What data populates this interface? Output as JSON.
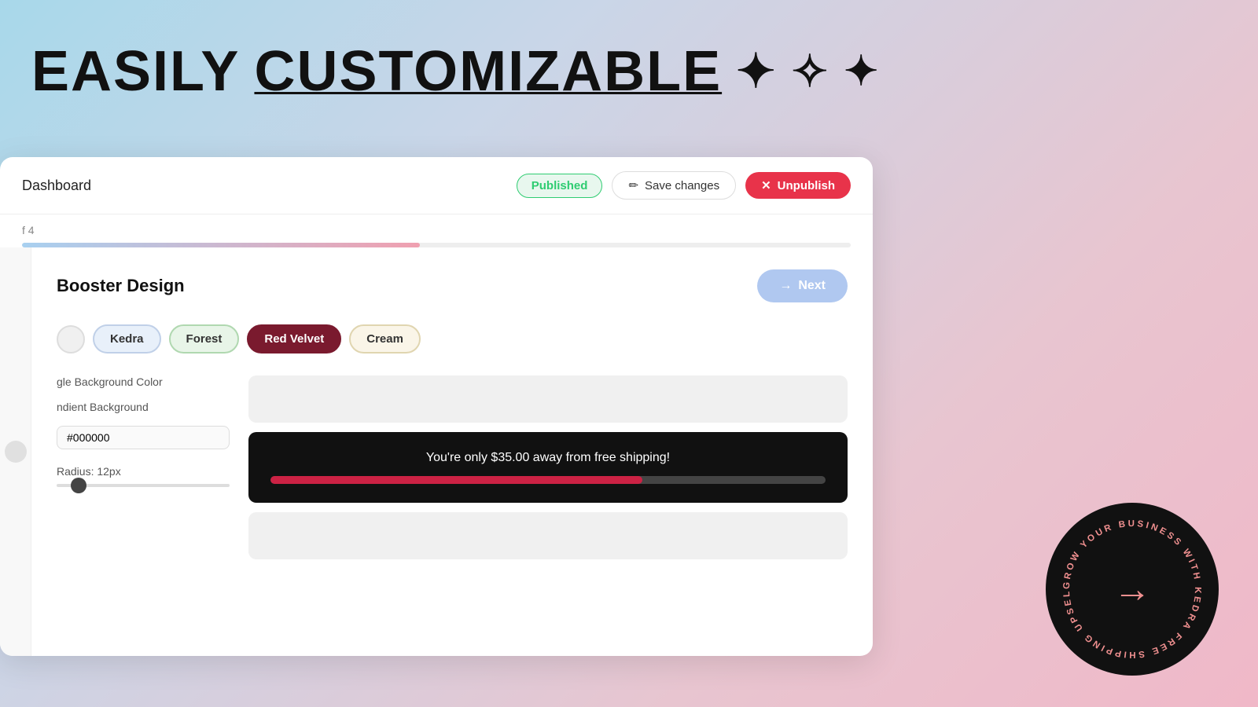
{
  "hero": {
    "title_part1": "EASILY",
    "title_part2": "CUSTOMIZABLE"
  },
  "header": {
    "breadcrumb": "Dashboard",
    "status_label": "Published",
    "save_label": "Save changes",
    "unpublish_label": "Unpublish"
  },
  "progress": {
    "step_label": "f 4",
    "fill_percent": 48
  },
  "design": {
    "section_title": "Booster Design",
    "next_label": "Next",
    "themes": [
      {
        "id": "default",
        "label": ""
      },
      {
        "id": "kedra",
        "label": "Kedra"
      },
      {
        "id": "forest",
        "label": "Forest"
      },
      {
        "id": "redvelvet",
        "label": "Red Velvet"
      },
      {
        "id": "cream",
        "label": "Cream"
      }
    ],
    "settings": {
      "background_label": "gle Background Color",
      "gradient_label": "ndient Background",
      "color_value": "#000000",
      "radius_label": "Radius: 12px",
      "radius_value": 12
    },
    "banner": {
      "text": "You're only $35.00 away from free shipping!",
      "progress_percent": 67
    }
  },
  "circular_badge": {
    "text": "GROW YOUR BUSINESS WITH KEDRA FREE SHIPPING UPSELL"
  },
  "icons": {
    "arrow_right": "→",
    "edit_icon": "✏",
    "close_icon": "✕",
    "star_filled": "✦",
    "star_outline": "✧"
  }
}
